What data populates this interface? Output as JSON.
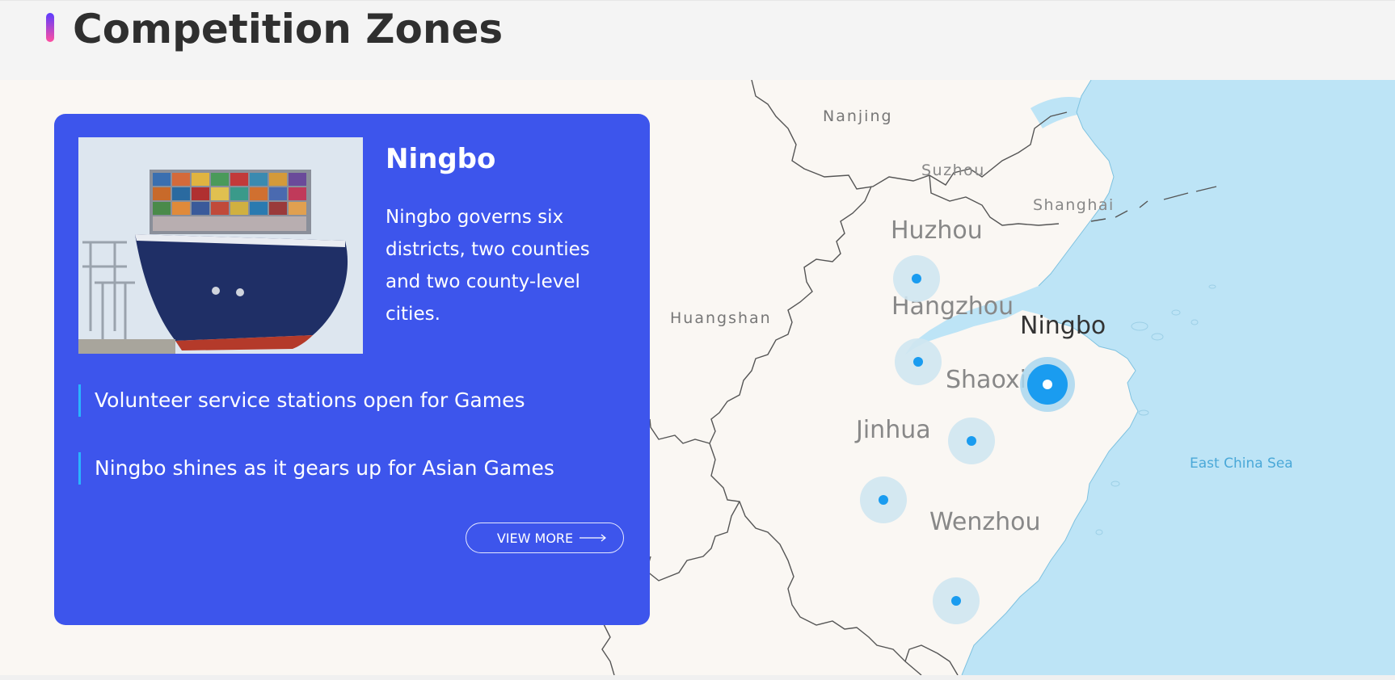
{
  "header": {
    "title": "Competition Zones"
  },
  "card": {
    "city": "Ningbo",
    "description": "Ningbo governs six districts, two counties and two county-level cities.",
    "news": [
      "Volunteer service stations open for Games",
      "Ningbo shines as it gears up for Asian Games"
    ],
    "view_more_label": "VIEW MORE",
    "photo_subject": "container-ship"
  },
  "map": {
    "reference_labels": [
      "Nanjing",
      "Suzhou",
      "Shanghai",
      "Huangshan",
      "East China Sea"
    ],
    "cities": [
      "Huzhou",
      "Hangzhou",
      "Ningbo",
      "Shaoxing",
      "Jinhua",
      "Wenzhou"
    ],
    "selected_city": "Ningbo"
  },
  "colors": {
    "card_bg": "#3d55ec",
    "sea": "#bde4f6",
    "land": "#faf7f3",
    "marker": "#1a9cf0",
    "marker_halo": "#cfe6f1",
    "news_bar": "#29b4ff"
  }
}
